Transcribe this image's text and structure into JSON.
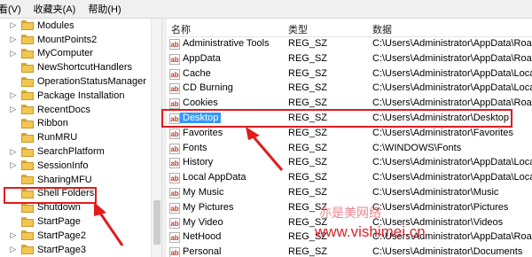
{
  "menu": [
    "看(V)",
    "收藏夹(A)",
    "帮助(H)"
  ],
  "tree": {
    "items": [
      {
        "label": "Modules"
      },
      {
        "label": "MountPoints2"
      },
      {
        "label": "MyComputer"
      },
      {
        "label": "NewShortcutHandlers"
      },
      {
        "label": "OperationStatusManager"
      },
      {
        "label": "Package Installation"
      },
      {
        "label": "RecentDocs"
      },
      {
        "label": "Ribbon"
      },
      {
        "label": "RunMRU"
      },
      {
        "label": "SearchPlatform"
      },
      {
        "label": "SessionInfo"
      },
      {
        "label": "SharingMFU"
      },
      {
        "label": "Shell Folders"
      },
      {
        "label": "Shutdown"
      },
      {
        "label": "StartPage"
      },
      {
        "label": "StartPage2"
      },
      {
        "label": "StartPage3"
      }
    ]
  },
  "columns": {
    "name": "名称",
    "type": "类型",
    "data": "数据"
  },
  "values": [
    {
      "name": "Administrative Tools",
      "type": "REG_SZ",
      "data": "C:\\Users\\Administrator\\AppData\\Roam"
    },
    {
      "name": "AppData",
      "type": "REG_SZ",
      "data": "C:\\Users\\Administrator\\AppData\\Roam"
    },
    {
      "name": "Cache",
      "type": "REG_SZ",
      "data": "C:\\Users\\Administrator\\AppData\\Local"
    },
    {
      "name": "CD Burning",
      "type": "REG_SZ",
      "data": "C:\\Users\\Administrator\\AppData\\Local"
    },
    {
      "name": "Cookies",
      "type": "REG_SZ",
      "data": "C:\\Users\\Administrator\\AppData\\Roam"
    },
    {
      "name": "Desktop",
      "type": "REG_SZ",
      "data": "C:\\Users\\Administrator\\Desktop"
    },
    {
      "name": "Favorites",
      "type": "REG_SZ",
      "data": "C:\\Users\\Administrator\\Favorites"
    },
    {
      "name": "Fonts",
      "type": "REG_SZ",
      "data": "C:\\WINDOWS\\Fonts"
    },
    {
      "name": "History",
      "type": "REG_SZ",
      "data": "C:\\Users\\Administrator\\AppData\\Local"
    },
    {
      "name": "Local AppData",
      "type": "REG_SZ",
      "data": "C:\\Users\\Administrator\\AppData\\Local"
    },
    {
      "name": "My Music",
      "type": "REG_SZ",
      "data": "C:\\Users\\Administrator\\Music"
    },
    {
      "name": "My Pictures",
      "type": "REG_SZ",
      "data": "C:\\Users\\Administrator\\Pictures"
    },
    {
      "name": "My Video",
      "type": "REG_SZ",
      "data": "C:\\Users\\Administrator\\Videos"
    },
    {
      "name": "NetHood",
      "type": "REG_SZ",
      "data": "C:\\Users\\Administrator\\AppData\\Roam"
    },
    {
      "name": "Personal",
      "type": "REG_SZ",
      "data": "C:\\Users\\Administrator\\Documents"
    }
  ],
  "value_icon_text": "ab",
  "watermark": {
    "cn": "亦是美网络",
    "url": "www.vishimei.cn"
  },
  "colors": {
    "highlight": "#e21b1b",
    "selection": "#3399ff"
  }
}
